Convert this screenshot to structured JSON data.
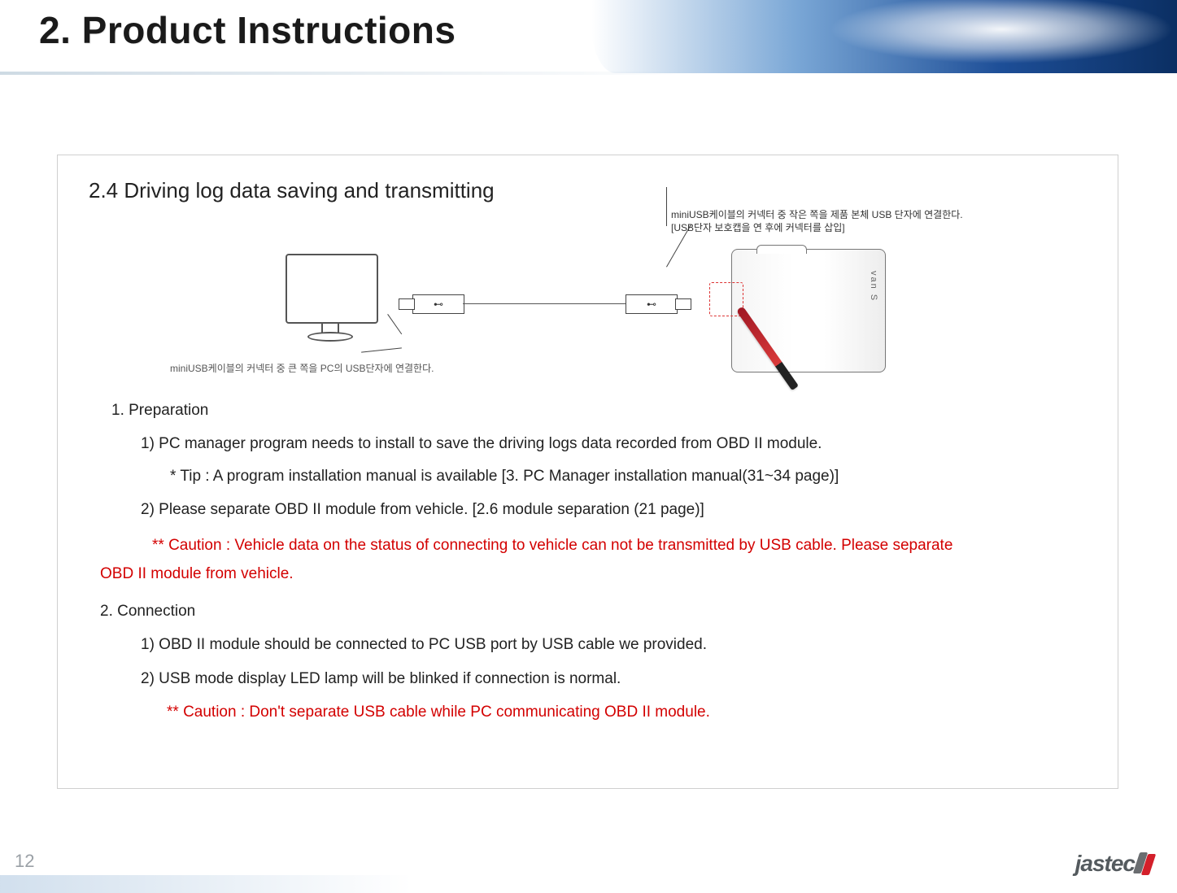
{
  "header": {
    "title": "2. Product Instructions"
  },
  "section": {
    "heading": "2.4 Driving log data saving and transmitting",
    "diagram": {
      "caption_left": "miniUSB케이블의 커넥터 중 큰 쪽을 PC의 USB단자에 연결한다.",
      "caption_right_line1": "miniUSB케이블의 커넥터 중 작은 쪽을 제품 본체 USB 단자에 연결한다.",
      "caption_right_line2": "[USB단자 보호캡을 연 후에 커넥터를 삽입]",
      "device_label": "van S"
    },
    "items": {
      "prep_title": "1.   Preparation",
      "prep_1": "1) PC manager program needs to install to save the driving logs data recorded from OBD II module.",
      "prep_tip": "* Tip : A program installation manual  is available [3. PC Manager installation manual(31~34 page)]",
      "prep_2": "2) Please separate OBD II module from vehicle. [2.6 module separation (21 page)]",
      "caution1_a": "** Caution : Vehicle data on the status of connecting to vehicle can not be transmitted by USB cable. Please separate",
      "caution1_b": "OBD II module from vehicle.",
      "conn_title": "2. Connection",
      "conn_1": "1) OBD II module should be connected to PC USB port by USB cable we provided.",
      "conn_2": "2) USB mode display LED lamp will be blinked if connection is normal.",
      "caution2": "** Caution : Don't separate USB cable while PC communicating OBD II module."
    }
  },
  "footer": {
    "page_number": "12",
    "logo_text": "jastec"
  }
}
